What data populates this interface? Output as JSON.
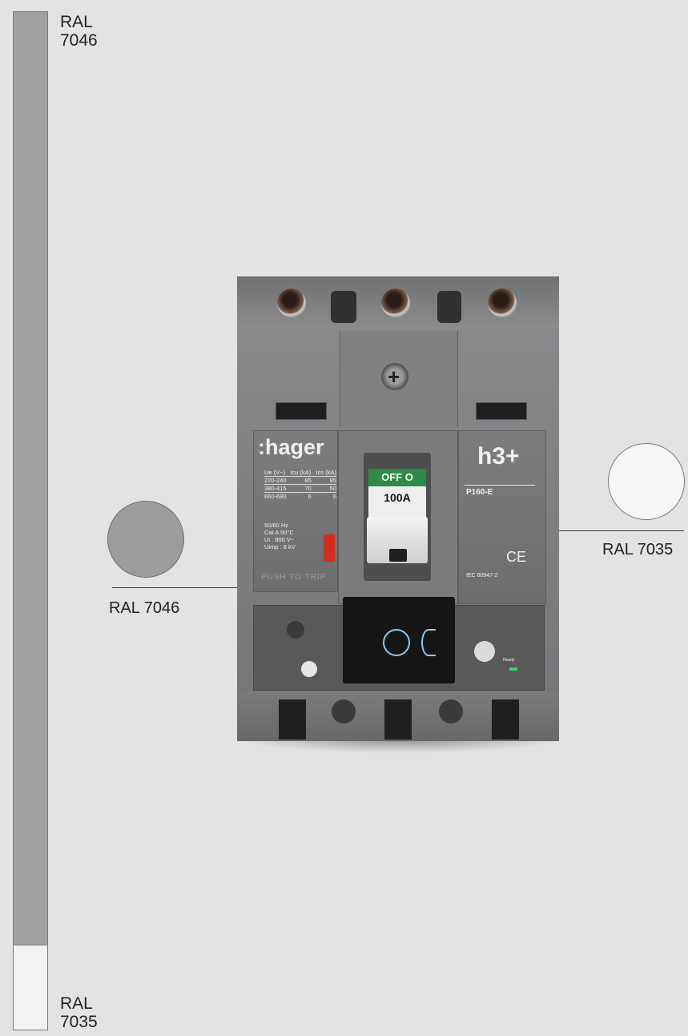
{
  "color_bar": {
    "top_label_line1": "RAL",
    "top_label_line2": "7046",
    "bottom_label_line1": "RAL",
    "bottom_label_line2": "7035",
    "top_color": "#a0a1a0",
    "bottom_color": "#f3f3f3"
  },
  "swatches": {
    "left_label": "RAL 7046",
    "left_color": "#9c9c9b",
    "right_label": "RAL 7035",
    "right_color": "#f6f6f5"
  },
  "breaker": {
    "brand": ":hager",
    "series_logo": "h3+",
    "model": "P160-E",
    "rating": "100A",
    "state": "OFF O",
    "push_to_trip": "PUSH TO TRIP",
    "standard": "IEC 60947-2",
    "ce_mark": "CE",
    "table_headers": [
      "Ue (V~)",
      "Icu (kA)",
      "Ics (kA)"
    ],
    "table_rows": [
      [
        "220-240",
        "85",
        "85"
      ],
      [
        "380-415",
        "70",
        "50"
      ],
      [
        "660-690",
        "6",
        "6"
      ]
    ],
    "spec_lines": [
      "50/60 Hz",
      "Cat A 50°C",
      "Ui : 800 V~",
      "Uimp : 8 kV"
    ],
    "ready_label": "Ready"
  }
}
